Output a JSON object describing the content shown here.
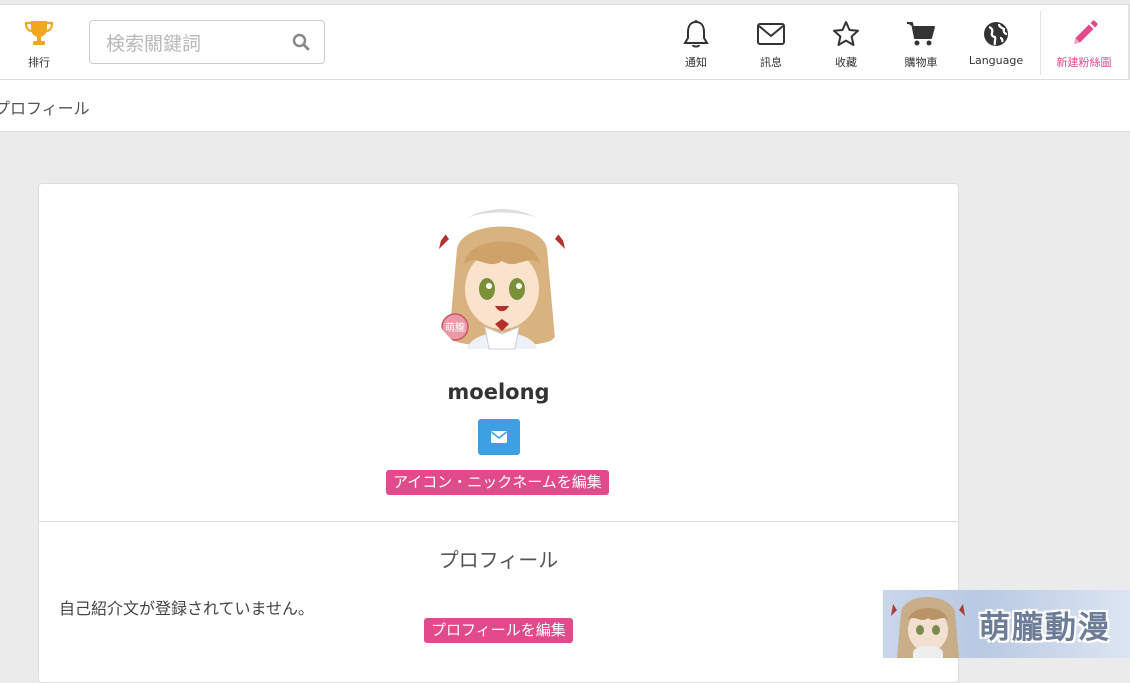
{
  "header": {
    "rank_label": "排行",
    "search_placeholder": "検索關鍵詞",
    "nav": {
      "notify": "通知",
      "message": "訊息",
      "favorite": "收藏",
      "cart": "購物車",
      "language": "Language",
      "new_fanart": "新建粉絲圖"
    }
  },
  "breadcrumb": "プロフィール",
  "profile": {
    "username": "moelong",
    "edit_icon_nick": "アイコン・ニックネームを編集",
    "section_title": "プロフィール",
    "bio": "自己紹介文が登録されていません。",
    "edit_profile": "プロフィールを編集"
  },
  "avatar_badge": "萌朧",
  "banner_text": "萌朧動漫",
  "colors": {
    "accent_pink": "#e14a8b",
    "button_blue": "#3da0e3",
    "trophy_gold": "#f1a81e"
  },
  "icons": [
    "trophy-icon",
    "search-icon",
    "bell-icon",
    "envelope-icon",
    "star-icon",
    "cart-icon",
    "globe-icon",
    "pencil-icon"
  ]
}
